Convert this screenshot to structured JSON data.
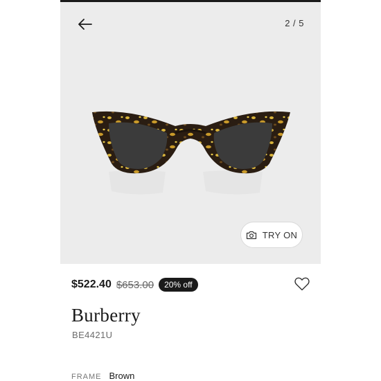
{
  "gallery": {
    "counter": "2 / 5",
    "try_on_label": "TRY ON"
  },
  "product": {
    "price": "$522.40",
    "original_price": "$653.00",
    "discount": "20% off",
    "brand": "Burberry",
    "model": "BE4421U",
    "specs": [
      {
        "label": "FRAME",
        "value": "Brown"
      }
    ]
  },
  "icons": {
    "back": "arrow-left-icon",
    "camera": "camera-icon",
    "wishlist": "heart-outline-icon"
  }
}
